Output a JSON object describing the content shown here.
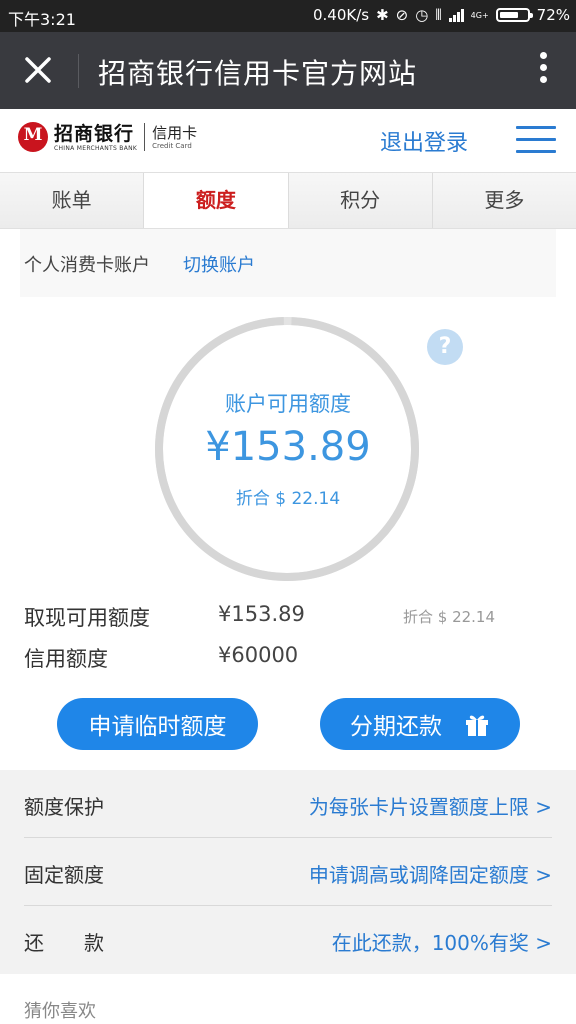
{
  "status_bar": {
    "time": "下午3:21",
    "network_speed": "0.40K/s",
    "network_label": "4G+",
    "battery_percent": "72%",
    "battery_level": 0.72,
    "icons": [
      "bluetooth-icon",
      "mute-icon",
      "alarm-icon",
      "vibrate-icon",
      "signal-icon",
      "battery-icon"
    ]
  },
  "title_bar": {
    "title": "招商银行信用卡官方网站",
    "close_icon": "close-icon",
    "more_icon": "more-vertical-icon"
  },
  "bank_header": {
    "logo_mark": "M",
    "logo_cn": "招商银行",
    "logo_en": "CHINA MERCHANTS BANK",
    "card_cn": "信用卡",
    "card_en": "Credit Card",
    "logout": "退出登录",
    "menu_icon": "hamburger-menu-icon"
  },
  "tabs": [
    {
      "label": "账单",
      "active": false
    },
    {
      "label": "额度",
      "active": true
    },
    {
      "label": "积分",
      "active": false
    },
    {
      "label": "更多",
      "active": false
    }
  ],
  "account": {
    "label": "个人消费卡账户",
    "switch": "切换账户"
  },
  "available": {
    "title": "账户可用额度",
    "amount": "¥153.89",
    "converted": "折合 $ 22.14",
    "help": "?",
    "ring_fill": 1.0
  },
  "info": {
    "cash_label": "取现可用额度",
    "cash_value": "¥153.89",
    "cash_converted": "折合 $ 22.14",
    "credit_label": "信用额度",
    "credit_value": "¥60000"
  },
  "buttons": {
    "temp_limit": "申请临时额度",
    "installment": "分期还款",
    "gift_icon": "gift-icon"
  },
  "list": [
    {
      "label": "额度保护",
      "link": "为每张卡片设置额度上限 >"
    },
    {
      "label": "固定额度",
      "link": "申请调高或调降固定额度 >"
    },
    {
      "label": "还　　款",
      "link": "在此还款，100%有奖 >"
    }
  ],
  "guess": "猜你喜欢",
  "colors": {
    "accent_blue": "#1f86e8",
    "link_blue": "#2a7bd1",
    "active_tab_red": "#cc1e1e",
    "title_bar": "#393a3f",
    "status_bar": "#222222"
  }
}
